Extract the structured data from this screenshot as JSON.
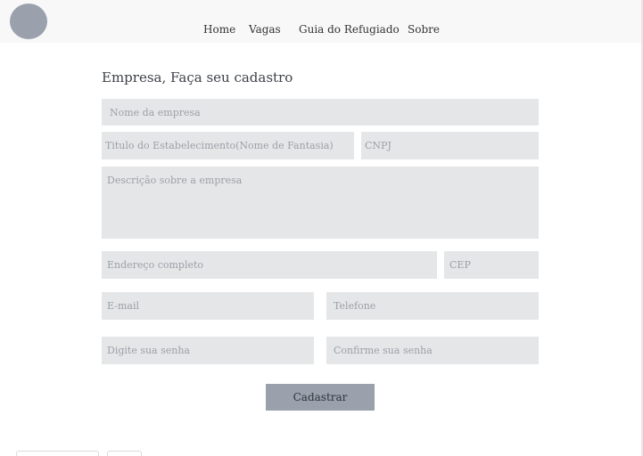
{
  "nav": {
    "items": [
      {
        "label": "Home"
      },
      {
        "label": "Vagas"
      },
      {
        "label": "Guia do Refugiado"
      },
      {
        "label": "Sobre"
      }
    ]
  },
  "form": {
    "title": "Empresa, Faça seu cadastro",
    "fields": {
      "company_name": {
        "placeholder": "Nome da empresa",
        "value": ""
      },
      "trade_name": {
        "placeholder": "Titulo do Estabelecimento(Nome de Fantasia)",
        "value": ""
      },
      "cnpj": {
        "placeholder": "CNPJ",
        "value": ""
      },
      "description": {
        "placeholder": "Descrição sobre a empresa",
        "value": ""
      },
      "address": {
        "placeholder": "Endereço completo",
        "value": ""
      },
      "cep": {
        "placeholder": "CEP",
        "value": ""
      },
      "email": {
        "placeholder": "E-mail",
        "value": ""
      },
      "phone": {
        "placeholder": "Telefone",
        "value": ""
      },
      "password": {
        "placeholder": "Digite sua senha",
        "value": ""
      },
      "password_confirm": {
        "placeholder": "Confirme sua senha",
        "value": ""
      }
    },
    "submit_label": "Cadastrar"
  }
}
